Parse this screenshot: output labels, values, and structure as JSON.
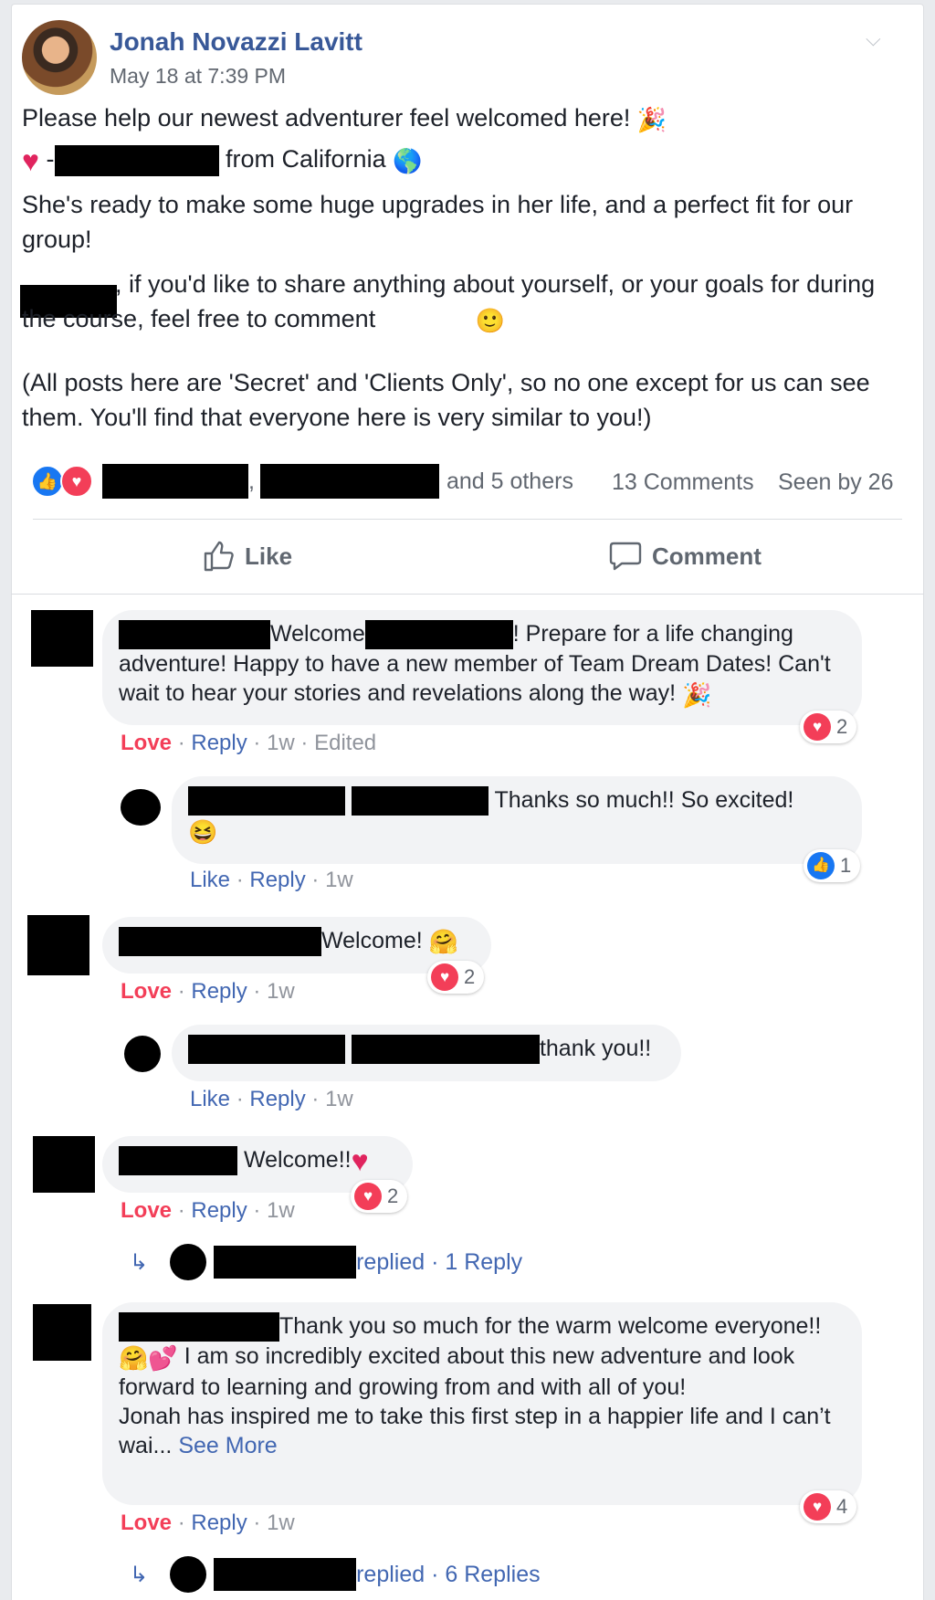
{
  "post": {
    "author": "Jonah Novazzi Lavitt",
    "timestamp": "May 18 at 7:39 PM",
    "line1": "Please help our newest adventurer feel welcomed here!",
    "line2_dash": "-",
    "line2_from": "from California",
    "line3": "She's ready to make some huge upgrades in her life, and a perfect fit for our group!",
    "line4": ", if you'd like to share anything about yourself, or your goals for during the course, feel free to comment",
    "line5": "(All posts here are 'Secret' and 'Clients Only', so no one except for us can see them. You'll find that everyone here is very similar to you!)",
    "icons": {
      "party": "party-popper-icon",
      "heart": "red-heart-icon",
      "globe": "globe-icon",
      "smile": "smiley-icon"
    }
  },
  "summary": {
    "comma": ",",
    "others": "and 5 others",
    "comments": "13 Comments",
    "seen": "Seen by 26"
  },
  "actions": {
    "like": "Like",
    "comment": "Comment"
  },
  "comments": [
    {
      "text_a": "Welcome",
      "text_b": "! Prepare for a life changing adventure! Happy to have a new member of Team Dream Dates! Can't wait to hear your stories and revelations along the way!",
      "meta": {
        "love": "Love",
        "reply": "Reply",
        "time": "1w",
        "edited": "Edited"
      },
      "reactions": "2"
    },
    {
      "text": "Thanks so much!! So excited!",
      "meta": {
        "like": "Like",
        "reply": "Reply",
        "time": "1w"
      },
      "reactions": "1"
    },
    {
      "text": "Welcome!",
      "meta": {
        "love": "Love",
        "reply": "Reply",
        "time": "1w"
      },
      "reactions": "2"
    },
    {
      "text": "thank you!!",
      "meta": {
        "like": "Like",
        "reply": "Reply",
        "time": "1w"
      }
    },
    {
      "text": "Welcome!!",
      "meta": {
        "love": "Love",
        "reply": "Reply",
        "time": "1w"
      },
      "reactions": "2",
      "replied": "replied · 1 Reply"
    },
    {
      "text_a": "Thank you so much for the warm welcome everyone!!",
      "text_b": "I am so incredibly excited about this new adventure and look forward to learning and growing from and with all of you!",
      "text_c": "Jonah has inspired me to take this first step in a happier life and I can’t wai...",
      "see_more": "See More",
      "meta": {
        "love": "Love",
        "reply": "Reply",
        "time": "1w"
      },
      "reactions": "4",
      "replied": "replied · 6 Replies"
    }
  ],
  "sep": "·"
}
